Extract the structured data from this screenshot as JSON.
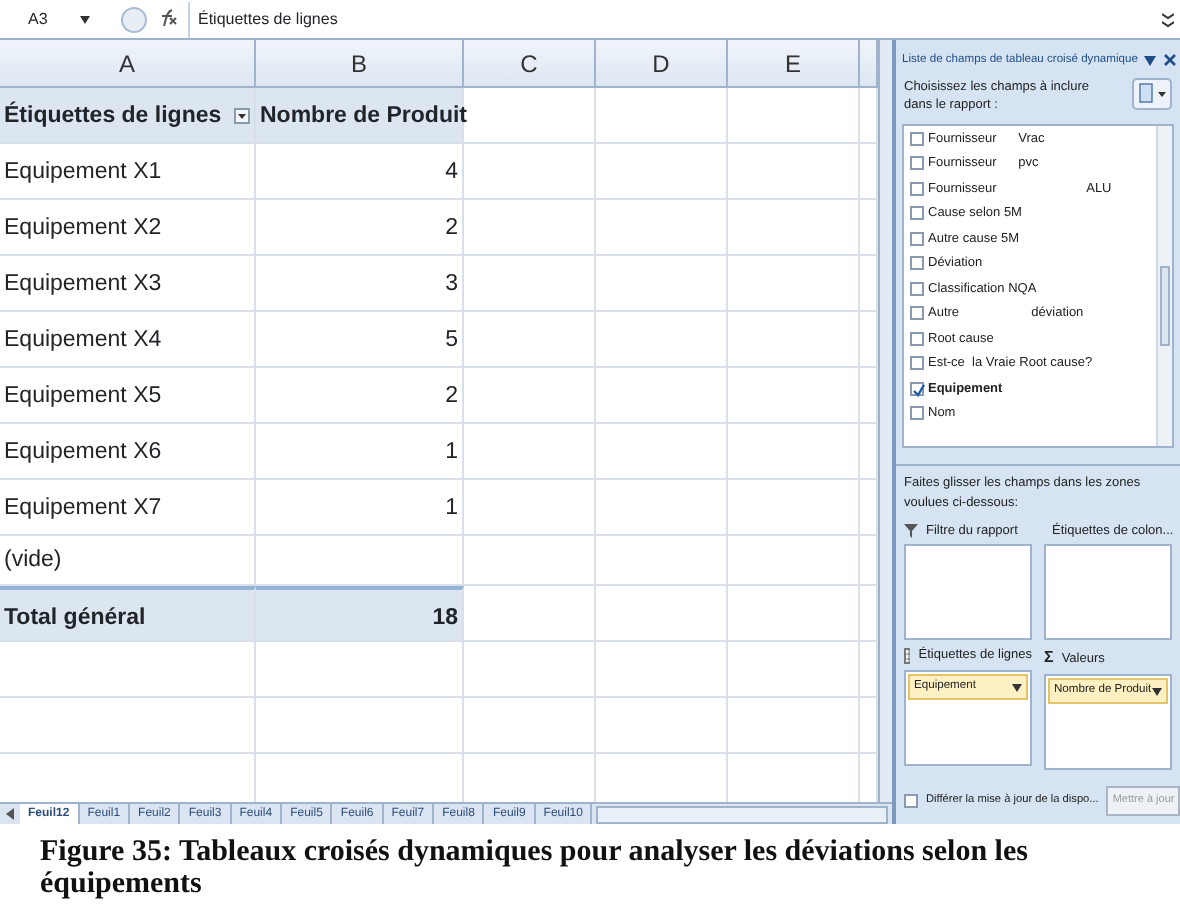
{
  "formula_bar": {
    "cell_ref": "A3",
    "formula": "Étiquettes de lignes"
  },
  "columns": [
    "A",
    "B",
    "C",
    "D",
    "E"
  ],
  "pivot": {
    "header": [
      "Étiquettes de lignes",
      "Nombre de Produit"
    ],
    "rows": [
      {
        "label": "Equipement X1",
        "count": "4"
      },
      {
        "label": "Equipement X2",
        "count": "2"
      },
      {
        "label": "Equipement X3",
        "count": "3"
      },
      {
        "label": "Equipement X4",
        "count": "5"
      },
      {
        "label": "Equipement X5",
        "count": "2"
      },
      {
        "label": "Equipement X6",
        "count": "1"
      },
      {
        "label": "Equipement X7",
        "count": "1"
      },
      {
        "label": "(vide)"
      }
    ],
    "total": {
      "label": "Total général",
      "count": "18"
    }
  },
  "sheet_tabs": [
    {
      "label": "Feuil12",
      "selected": true
    },
    {
      "label": "Feuil1",
      "selected": false
    },
    {
      "label": "Feuil2",
      "selected": false
    },
    {
      "label": "Feuil3",
      "selected": false
    },
    {
      "label": "Feuil4",
      "selected": false
    },
    {
      "label": "Feuil5",
      "selected": false
    },
    {
      "label": "Feuil6",
      "selected": false
    },
    {
      "label": "Feuil7",
      "selected": false
    },
    {
      "label": "Feuil8",
      "selected": false
    },
    {
      "label": "Feuil9",
      "selected": false
    },
    {
      "label": "Feuil10",
      "selected": false
    }
  ],
  "pane": {
    "title": "Liste de champs de tableau croisé dynamique",
    "choose_label": "Choisissez les champs à inclure dans le rapport :",
    "fields": [
      {
        "label": "Fournisseur      Vrac",
        "checked": false
      },
      {
        "label": "Fournisseur      pvc",
        "checked": false
      },
      {
        "label": "Fournisseur                         ALU",
        "checked": false
      },
      {
        "label": "Cause selon 5M",
        "checked": false
      },
      {
        "label": "Autre cause 5M",
        "checked": false
      },
      {
        "label": "Déviation",
        "checked": false
      },
      {
        "label": "Classification NQA",
        "checked": false
      },
      {
        "label": "Autre                    déviation",
        "checked": false
      },
      {
        "label": "Root cause",
        "checked": false
      },
      {
        "label": "Est-ce  la Vraie Root cause?",
        "checked": false
      },
      {
        "label": "Equipement",
        "checked": true
      },
      {
        "label": "Nom",
        "checked": false
      }
    ],
    "drag_label": "Faites glisser les champs dans les zones voulues ci-dessous:",
    "zones": [
      {
        "kind": "filter",
        "label": "Filtre du rapport"
      },
      {
        "kind": "columns",
        "label": "Étiquettes de colon..."
      },
      {
        "kind": "rows",
        "label": "Étiquettes de lignes",
        "items": [
          "Equipement"
        ]
      },
      {
        "kind": "values",
        "symbol": "Σ",
        "label": "Valeurs",
        "items": [
          "Nombre de Produit"
        ]
      }
    ],
    "defer": {
      "label": "Différer la mise à jour de la dispo...",
      "checked": false
    },
    "update_button": {
      "label": "Mettre à jour",
      "disabled": true
    }
  },
  "caption": "Figure 35: Tableaux croisés dynamiques pour analyser les déviations selon les équipements"
}
